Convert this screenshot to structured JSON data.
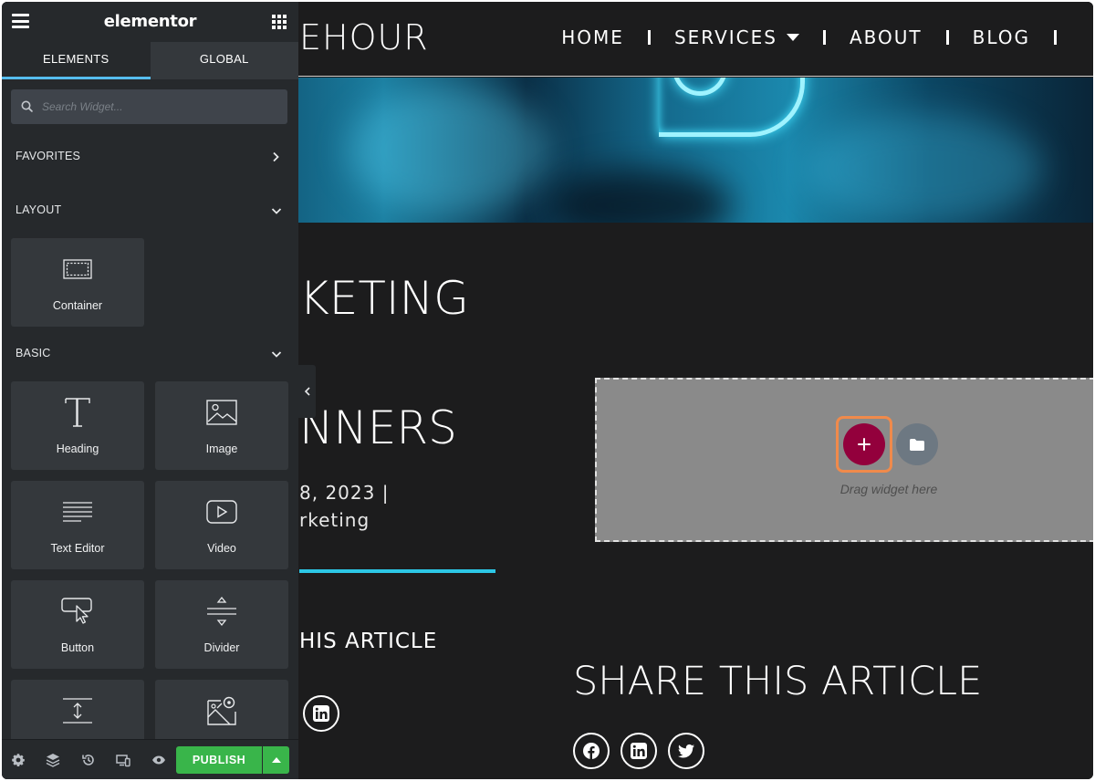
{
  "site": {
    "logo_text": "EHOUR",
    "nav": [
      {
        "label": "HOME"
      },
      {
        "label": "SERVICES",
        "has_dropdown": true
      },
      {
        "label": "ABOUT"
      },
      {
        "label": "BLOG"
      }
    ],
    "heading_line1": "KETING",
    "heading_line2": "NNERS",
    "meta_date": "8, 2023 |",
    "meta_category": "rketing",
    "share_small": "HIS ARTICLE",
    "share_big": "SHARE THIS ARTICLE",
    "social_icons": [
      "facebook-icon",
      "linkedin-icon",
      "twitter-icon"
    ],
    "accent_color": "#2cc7e6"
  },
  "dropzone": {
    "hint": "Drag widget here",
    "add_color": "#93003c",
    "highlight_color": "#f08a4b"
  },
  "panel": {
    "brand": "elementor",
    "tabs": [
      {
        "label": "ELEMENTS",
        "active": true
      },
      {
        "label": "GLOBAL",
        "active": false
      }
    ],
    "search_placeholder": "Search Widget...",
    "sections": {
      "favorites": "FAVORITES",
      "layout": "LAYOUT",
      "basic": "BASIC"
    },
    "layout_widgets": [
      {
        "label": "Container",
        "icon": "container-icon"
      }
    ],
    "basic_widgets": [
      {
        "label": "Heading",
        "icon": "heading-icon"
      },
      {
        "label": "Image",
        "icon": "image-icon"
      },
      {
        "label": "Text Editor",
        "icon": "text-editor-icon"
      },
      {
        "label": "Video",
        "icon": "video-icon"
      },
      {
        "label": "Button",
        "icon": "button-icon"
      },
      {
        "label": "Divider",
        "icon": "divider-icon"
      },
      {
        "label": "",
        "icon": "spacer-icon"
      },
      {
        "label": "",
        "icon": "google-maps-icon"
      }
    ],
    "footer": {
      "publish_label": "PUBLISH",
      "publish_color": "#39b54a",
      "icons": [
        "settings-icon",
        "navigator-icon",
        "history-icon",
        "responsive-icon",
        "preview-icon"
      ]
    },
    "accent_color": "#56bdef"
  }
}
